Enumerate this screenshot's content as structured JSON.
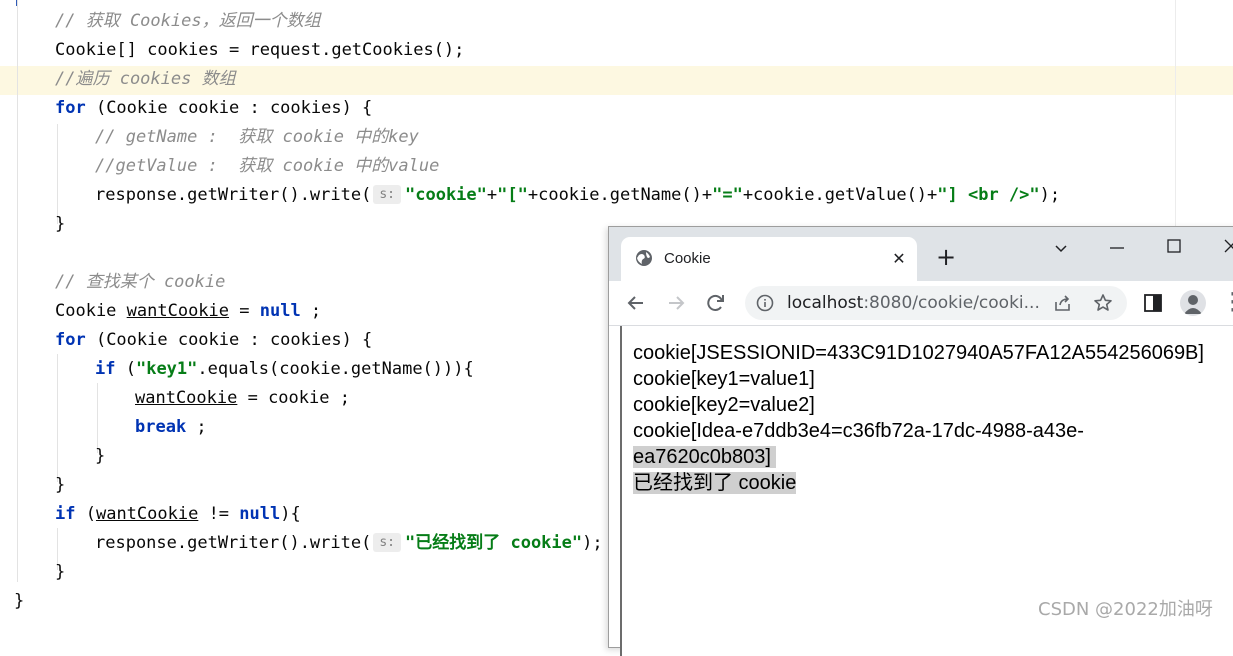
{
  "editor": {
    "lines": [
      {
        "indent": 1,
        "tokens": [
          {
            "t": "// 获取 Cookies，返回一个数组",
            "c": "cm"
          }
        ]
      },
      {
        "indent": 1,
        "tokens": [
          {
            "t": "Cookie[] cookies = request.getCookies();"
          }
        ]
      },
      {
        "indent": 1,
        "tokens": [
          {
            "t": "//遍历 cookies 数组",
            "c": "cm"
          }
        ]
      },
      {
        "indent": 1,
        "tokens": [
          {
            "t": "for",
            "c": "kw"
          },
          {
            "t": " (Cookie cookie : cookies) {"
          }
        ]
      },
      {
        "indent": 2,
        "tokens": [
          {
            "t": "// getName :  获取 cookie 中的key",
            "c": "cm"
          }
        ]
      },
      {
        "indent": 2,
        "tokens": [
          {
            "t": "//getValue :  获取 cookie 中的value",
            "c": "cm"
          }
        ]
      },
      {
        "indent": 2,
        "tokens": [
          {
            "t": "response.getWriter().write("
          },
          {
            "t": "s:",
            "c": "hint"
          },
          {
            "t": "\"cookie\"",
            "c": "str"
          },
          {
            "t": "+"
          },
          {
            "t": "\"[\"",
            "c": "str"
          },
          {
            "t": "+cookie.getName()+"
          },
          {
            "t": "\"=\"",
            "c": "str"
          },
          {
            "t": "+cookie.getValue()+"
          },
          {
            "t": "\"] <br />\"",
            "c": "str"
          },
          {
            "t": ");"
          }
        ]
      },
      {
        "indent": 1,
        "tokens": [
          {
            "t": "}"
          }
        ]
      },
      {
        "indent": 0,
        "tokens": []
      },
      {
        "indent": 1,
        "tokens": [
          {
            "t": "// 查找某个 cookie",
            "c": "cm"
          }
        ]
      },
      {
        "indent": 1,
        "tokens": [
          {
            "t": "Cookie "
          },
          {
            "t": "wantCookie",
            "c": "ul"
          },
          {
            "t": " = "
          },
          {
            "t": "null",
            "c": "kw"
          },
          {
            "t": " ;"
          }
        ]
      },
      {
        "indent": 1,
        "tokens": [
          {
            "t": "for",
            "c": "kw"
          },
          {
            "t": " (Cookie cookie : cookies) {"
          }
        ]
      },
      {
        "indent": 2,
        "tokens": [
          {
            "t": "if",
            "c": "kw"
          },
          {
            "t": " ("
          },
          {
            "t": "\"key1\"",
            "c": "str"
          },
          {
            "t": ".equals(cookie.getName())){"
          }
        ]
      },
      {
        "indent": 3,
        "tokens": [
          {
            "t": "wantCookie",
            "c": "ul"
          },
          {
            "t": " = cookie ;"
          }
        ]
      },
      {
        "indent": 3,
        "tokens": [
          {
            "t": "break",
            "c": "kw"
          },
          {
            "t": " ;"
          }
        ]
      },
      {
        "indent": 2,
        "tokens": [
          {
            "t": "}"
          }
        ]
      },
      {
        "indent": 1,
        "tokens": [
          {
            "t": "}"
          }
        ]
      },
      {
        "indent": 1,
        "tokens": [
          {
            "t": "if",
            "c": "kw"
          },
          {
            "t": " ("
          },
          {
            "t": "wantCookie",
            "c": "ul"
          },
          {
            "t": " != "
          },
          {
            "t": "null",
            "c": "kw"
          },
          {
            "t": "){"
          }
        ]
      },
      {
        "indent": 2,
        "tokens": [
          {
            "t": "response.getWriter().write("
          },
          {
            "t": "s:",
            "c": "hint"
          },
          {
            "t": "\"已经找到了 cookie\"",
            "c": "str"
          },
          {
            "t": ");"
          }
        ]
      },
      {
        "indent": 1,
        "tokens": [
          {
            "t": "}"
          }
        ]
      },
      {
        "indent": 0,
        "tokens": [
          {
            "t": "}"
          }
        ]
      }
    ]
  },
  "browser": {
    "tab_title": "Cookie",
    "url_host": "localhost",
    "url_rest": ":8080/cookie/cooki...",
    "content_lines": [
      {
        "text": "cookie[JSESSIONID=433C91D1027940A57FA12A554256069B]",
        "selected": false
      },
      {
        "text": "cookie[key1=value1]",
        "selected": false
      },
      {
        "text": "cookie[key2=value2]",
        "selected": false
      },
      {
        "text": "cookie[Idea-e7ddb3e4=c36fb72a-17dc-4988-a43e-",
        "selected": false
      },
      {
        "text": "ea7620c0b803] ",
        "selected": true
      },
      {
        "text": "已经找到了 cookie",
        "selected": true
      }
    ]
  },
  "watermark": "CSDN @2022加油呀"
}
